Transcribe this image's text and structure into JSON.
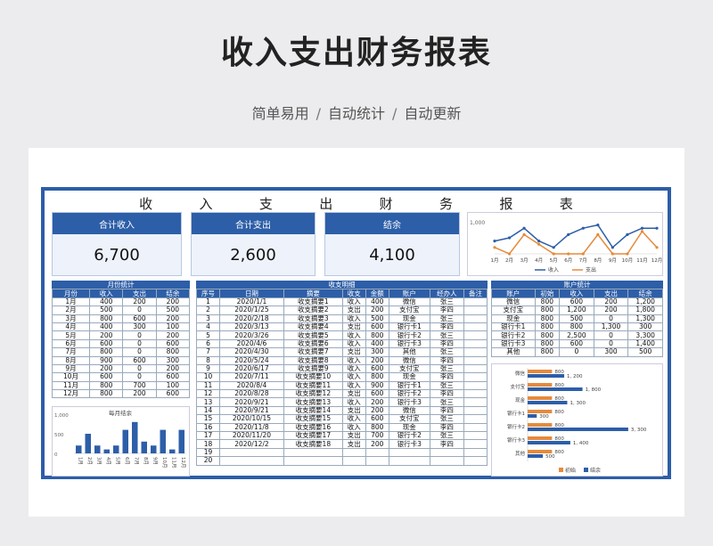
{
  "header": {
    "title": "收入支出财务报表",
    "tags": [
      "简单易用",
      "自动统计",
      "自动更新"
    ],
    "separator": "/"
  },
  "sheet": {
    "title_chars": [
      "收",
      "入",
      "支",
      "出",
      "财",
      "务",
      "报",
      "表"
    ],
    "kpis": [
      {
        "label": "合计收入",
        "value": "6,700"
      },
      {
        "label": "合计支出",
        "value": "2,600"
      },
      {
        "label": "结余",
        "value": "4,100"
      }
    ],
    "monthly": {
      "caption": "月份统计",
      "headers": [
        "月份",
        "收入",
        "支出",
        "结余"
      ],
      "rows": [
        [
          "1月",
          "400",
          "200",
          "200"
        ],
        [
          "2月",
          "500",
          "0",
          "500"
        ],
        [
          "3月",
          "800",
          "600",
          "200"
        ],
        [
          "4月",
          "400",
          "300",
          "100"
        ],
        [
          "5月",
          "200",
          "0",
          "200"
        ],
        [
          "6月",
          "600",
          "0",
          "600"
        ],
        [
          "7月",
          "800",
          "0",
          "800"
        ],
        [
          "8月",
          "900",
          "600",
          "300"
        ],
        [
          "9月",
          "200",
          "0",
          "200"
        ],
        [
          "10月",
          "600",
          "0",
          "600"
        ],
        [
          "11月",
          "800",
          "700",
          "100"
        ],
        [
          "12月",
          "800",
          "200",
          "600"
        ]
      ]
    },
    "detail": {
      "caption": "收支明细",
      "headers": [
        "序号",
        "日期",
        "摘要",
        "收支",
        "金额",
        "账户",
        "经办人",
        "备注"
      ],
      "rows": [
        [
          "1",
          "2020/1/1",
          "收支摘要1",
          "收入",
          "400",
          "微信",
          "张三",
          ""
        ],
        [
          "2",
          "2020/1/25",
          "收支摘要2",
          "支出",
          "200",
          "支付宝",
          "李四",
          ""
        ],
        [
          "3",
          "2020/2/18",
          "收支摘要3",
          "收入",
          "500",
          "现金",
          "张三",
          ""
        ],
        [
          "4",
          "2020/3/13",
          "收支摘要4",
          "支出",
          "600",
          "银行卡1",
          "李四",
          ""
        ],
        [
          "5",
          "2020/3/26",
          "收支摘要5",
          "收入",
          "800",
          "银行卡2",
          "张三",
          ""
        ],
        [
          "6",
          "2020/4/6",
          "收支摘要6",
          "收入",
          "400",
          "银行卡3",
          "李四",
          ""
        ],
        [
          "7",
          "2020/4/30",
          "收支摘要7",
          "支出",
          "300",
          "其他",
          "张三",
          ""
        ],
        [
          "8",
          "2020/5/24",
          "收支摘要8",
          "收入",
          "200",
          "微信",
          "李四",
          ""
        ],
        [
          "9",
          "2020/6/17",
          "收支摘要9",
          "收入",
          "600",
          "支付宝",
          "张三",
          ""
        ],
        [
          "10",
          "2020/7/11",
          "收支摘要10",
          "收入",
          "800",
          "现金",
          "李四",
          ""
        ],
        [
          "11",
          "2020/8/4",
          "收支摘要11",
          "收入",
          "900",
          "银行卡1",
          "张三",
          ""
        ],
        [
          "12",
          "2020/8/28",
          "收支摘要12",
          "支出",
          "600",
          "银行卡2",
          "李四",
          ""
        ],
        [
          "13",
          "2020/9/21",
          "收支摘要13",
          "收入",
          "200",
          "银行卡3",
          "张三",
          ""
        ],
        [
          "14",
          "2020/9/21",
          "收支摘要14",
          "支出",
          "200",
          "微信",
          "李四",
          ""
        ],
        [
          "15",
          "2020/10/15",
          "收支摘要15",
          "收入",
          "600",
          "支付宝",
          "张三",
          ""
        ],
        [
          "16",
          "2020/11/8",
          "收支摘要16",
          "收入",
          "800",
          "现金",
          "李四",
          ""
        ],
        [
          "17",
          "2020/11/20",
          "收支摘要17",
          "支出",
          "700",
          "银行卡2",
          "张三",
          ""
        ],
        [
          "18",
          "2020/12/2",
          "收支摘要18",
          "支出",
          "200",
          "银行卡3",
          "李四",
          ""
        ],
        [
          "19",
          "",
          "",
          "",
          "",
          "",
          "",
          ""
        ],
        [
          "20",
          "",
          "",
          "",
          "",
          "",
          "",
          ""
        ]
      ]
    },
    "accounts": {
      "caption": "账户统计",
      "headers": [
        "账户",
        "初始",
        "收入",
        "支出",
        "结余"
      ],
      "rows": [
        [
          "微信",
          "800",
          "600",
          "200",
          "1,200"
        ],
        [
          "支付宝",
          "800",
          "1,200",
          "200",
          "1,800"
        ],
        [
          "现金",
          "800",
          "500",
          "0",
          "1,300"
        ],
        [
          "银行卡1",
          "800",
          "800",
          "1,300",
          "300"
        ],
        [
          "银行卡2",
          "800",
          "2,500",
          "0",
          "3,300"
        ],
        [
          "银行卡3",
          "800",
          "600",
          "0",
          "1,400"
        ],
        [
          "其他",
          "800",
          "0",
          "300",
          "500"
        ]
      ]
    }
  },
  "chart_data": [
    {
      "type": "line",
      "title": "",
      "categories": [
        "1月",
        "2月",
        "3月",
        "4月",
        "5月",
        "6月",
        "7月",
        "8月",
        "9月",
        "10月",
        "11月",
        "12月"
      ],
      "series": [
        {
          "name": "收入",
          "values": [
            400,
            500,
            800,
            400,
            200,
            600,
            800,
            900,
            200,
            600,
            800,
            800
          ],
          "color": "#2d5ea8"
        },
        {
          "name": "支出",
          "values": [
            200,
            0,
            600,
            300,
            0,
            0,
            0,
            600,
            0,
            0,
            700,
            200
          ],
          "color": "#e58a3c"
        }
      ],
      "ylim": [
        0,
        1000
      ],
      "yticks": [
        "1,000"
      ],
      "legend": "bottom"
    },
    {
      "type": "bar",
      "title": "每月结余",
      "categories": [
        "1月",
        "2月",
        "3月",
        "4月",
        "5月",
        "6月",
        "7月",
        "8月",
        "9月",
        "10月",
        "11月",
        "12月"
      ],
      "values": [
        200,
        500,
        200,
        100,
        200,
        600,
        800,
        300,
        200,
        600,
        100,
        600
      ],
      "ylim": [
        0,
        1000
      ],
      "yticks": [
        "1,000",
        "500",
        "0"
      ],
      "color": "#2d5ea8"
    },
    {
      "type": "bar",
      "orientation": "horizontal",
      "categories": [
        "微信",
        "支付宝",
        "现金",
        "银行卡1",
        "银行卡2",
        "银行卡3",
        "其他"
      ],
      "series": [
        {
          "name": "初始",
          "values": [
            800,
            800,
            800,
            800,
            800,
            800,
            800
          ],
          "labels": [
            "800",
            "800",
            "800",
            "800",
            "800",
            "800",
            "800"
          ],
          "color": "#e58a3c"
        },
        {
          "name": "结余",
          "values": [
            1200,
            1800,
            1300,
            300,
            3300,
            1400,
            500
          ],
          "labels": [
            "1, 200",
            "1, 800",
            "1, 300",
            "300",
            "3, 300",
            "1, 400",
            "500"
          ],
          "color": "#2d5ea8"
        }
      ],
      "xlim": [
        0,
        3800
      ],
      "legend": "bottom"
    }
  ]
}
